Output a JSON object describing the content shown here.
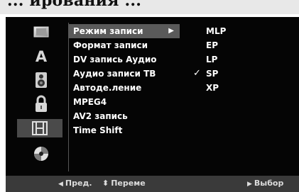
{
  "document": {
    "heading_fragment": "... ирования ..."
  },
  "sidebar": {
    "items": [
      {
        "icon": "disc-video-icon",
        "active": false
      },
      {
        "icon": "language-a-icon",
        "active": false
      },
      {
        "icon": "speaker-icon",
        "active": false
      },
      {
        "icon": "lock-icon",
        "active": false
      },
      {
        "icon": "film-recording-icon",
        "active": true
      },
      {
        "icon": "disc-icon",
        "active": false
      }
    ]
  },
  "menu": {
    "items": [
      {
        "label": "Режим записи",
        "selected": true,
        "has_submenu": true
      },
      {
        "label": "Формат записи"
      },
      {
        "label": "DV запись Аудио"
      },
      {
        "label": "Аудио записи ТВ"
      },
      {
        "label": "Автоде.ление"
      },
      {
        "label": "MPEG4"
      },
      {
        "label": "AV2 запись"
      },
      {
        "label": "Time Shift"
      }
    ]
  },
  "options": {
    "items": [
      {
        "label": "MLP",
        "checked": false
      },
      {
        "label": "EP",
        "checked": false
      },
      {
        "label": "LP",
        "checked": false
      },
      {
        "label": "SP",
        "checked": true
      },
      {
        "label": "XP",
        "checked": false
      }
    ]
  },
  "footer": {
    "prev": "Пред.",
    "move": "Переме",
    "select": "Выбор"
  },
  "colors": {
    "screen_bg": "#050505",
    "highlight": "#5a5a5a",
    "footer_bg": "#3a3a3a",
    "text": "#ffffff"
  }
}
